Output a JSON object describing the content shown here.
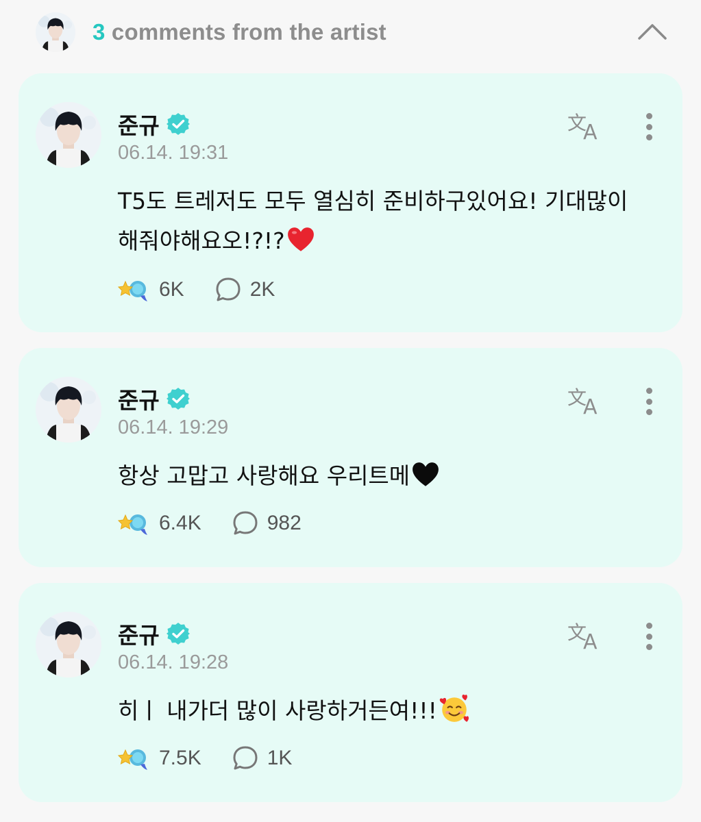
{
  "header": {
    "count": "3",
    "title_rest": " comments from the artist",
    "collapse_icon": "chevron-up-icon"
  },
  "colors": {
    "accent": "#25c7c0",
    "card_bg": "#e6fbf6",
    "heart_red": "#e8242f"
  },
  "comments": [
    {
      "author": "준규",
      "time": "06.14. 19:31",
      "text": "T5도 트레저도 모두 열심히 준비하구있어요! 기대많이해줘야해요오!?!?",
      "emoji": "red-heart",
      "likes": "6K",
      "replies": "2K"
    },
    {
      "author": "준규",
      "time": "06.14. 19:29",
      "text": "항상 고맙고 사랑해요 우리트메",
      "emoji": "black-heart",
      "likes": "6.4K",
      "replies": "982"
    },
    {
      "author": "준규",
      "time": "06.14. 19:28",
      "text": "히ㅣ 내가더 많이 사랑하거든여!!!",
      "emoji": "smiling-face-with-hearts",
      "likes": "7.5K",
      "replies": "1K"
    }
  ]
}
